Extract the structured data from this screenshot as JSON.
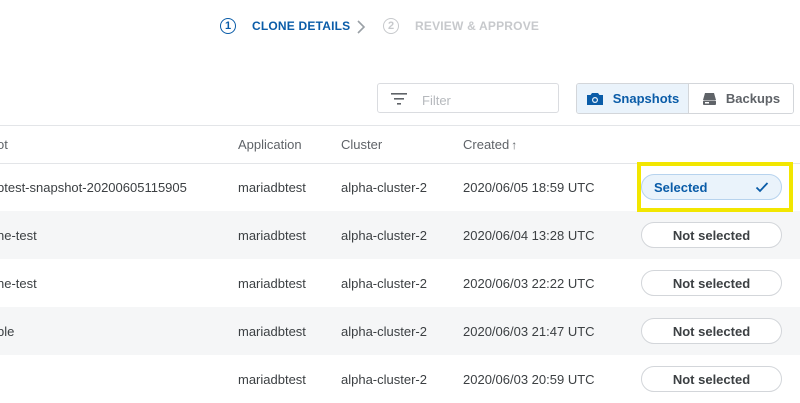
{
  "stepper": {
    "steps": [
      {
        "number": "1",
        "label": "CLONE DETAILS",
        "active": true
      },
      {
        "number": "2",
        "label": "REVIEW & APPROVE",
        "active": false
      }
    ]
  },
  "toolbar": {
    "filter_placeholder": "Filter",
    "view_toggle": {
      "snapshots_label": "Snapshots",
      "backups_label": "Backups",
      "selected": "Snapshots"
    }
  },
  "table": {
    "columns": {
      "name": "ot",
      "application": "Application",
      "cluster": "Cluster",
      "created": "Created",
      "created_sort": "↑"
    },
    "rows": [
      {
        "name": "btest-snapshot-20200605115905",
        "application": "mariadbtest",
        "cluster": "alpha-cluster-2",
        "created": "2020/06/05 18:59 UTC",
        "selection": "Selected"
      },
      {
        "name": "ne-test",
        "application": "mariadbtest",
        "cluster": "alpha-cluster-2",
        "created": "2020/06/04 13:28 UTC",
        "selection": "Not selected"
      },
      {
        "name": "ne-test",
        "application": "mariadbtest",
        "cluster": "alpha-cluster-2",
        "created": "2020/06/03 22:22 UTC",
        "selection": "Not selected"
      },
      {
        "name": "ble",
        "application": "mariadbtest",
        "cluster": "alpha-cluster-2",
        "created": "2020/06/03 21:47 UTC",
        "selection": "Not selected"
      },
      {
        "name": "",
        "application": "mariadbtest",
        "cluster": "alpha-cluster-2",
        "created": "2020/06/03 20:59 UTC",
        "selection": "Not selected"
      }
    ]
  },
  "colors": {
    "accent": "#0a5ca8",
    "highlight": "#f2e600",
    "row_alt": "#f5f6f7"
  }
}
